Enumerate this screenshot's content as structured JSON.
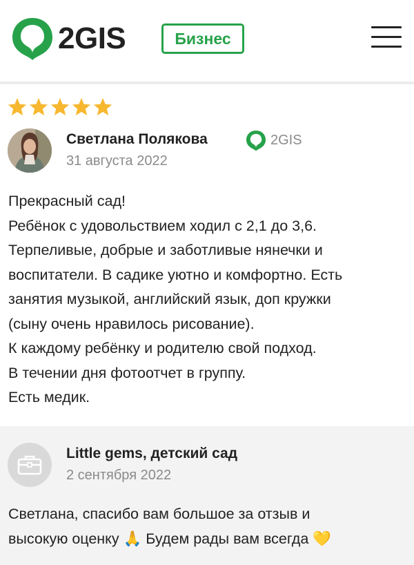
{
  "header": {
    "logo_text": "2GIS",
    "badge_label": "Бизнес",
    "brand_color": "#27a24a"
  },
  "review": {
    "rating": 5,
    "rating_max": 5,
    "author": "Светлана Полякова",
    "source": "2GIS",
    "date": "31 августа 2022",
    "lines": [
      "Прекрасный сад!",
      "Ребёнок с удовольствием ходил с 2,1 до 3,6.",
      "Терпеливые, добрые и заботливые нянечки и",
      "воспитатели. В садике уютно и комфортно. Есть",
      "занятия музыкой, английский язык, доп кружки",
      "(сыну очень нравилось рисование).",
      "К каждому ребёнку и родителю свой подход.",
      "В течении дня фотоотчет в группу.",
      "Есть медик."
    ]
  },
  "reply": {
    "org_name": "Little gems, детский сад",
    "date": "2 сентября 2022",
    "lines": [
      "Светлана, спасибо вам большое за отзыв и",
      "высокую оценку 🙏 Будем рады вам всегда 💛"
    ]
  },
  "icons": {
    "logo": "2gis-pin-icon",
    "menu": "hamburger-menu-icon",
    "star": "star-icon",
    "source": "2gis-pin-icon",
    "org": "briefcase-icon"
  }
}
